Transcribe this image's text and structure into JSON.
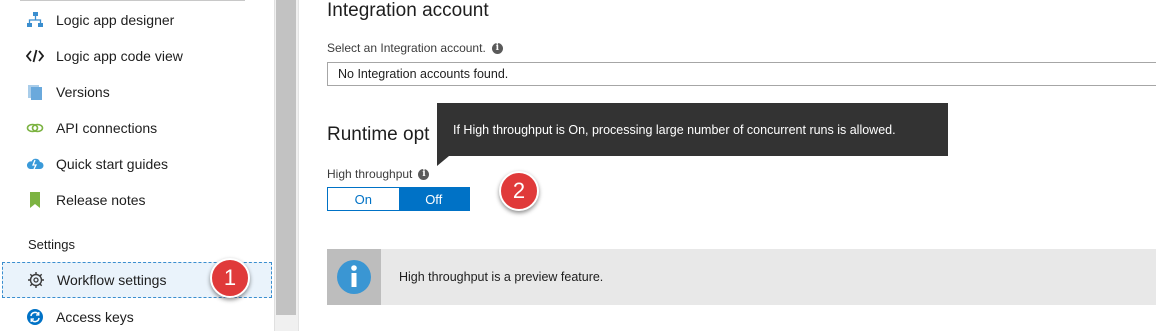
{
  "sidebar": {
    "items": [
      {
        "label": "Logic app designer",
        "icon": "designer-icon"
      },
      {
        "label": "Logic app code view",
        "icon": "code-icon"
      },
      {
        "label": "Versions",
        "icon": "versions-icon"
      },
      {
        "label": "API connections",
        "icon": "link-icon"
      },
      {
        "label": "Quick start guides",
        "icon": "cloud-icon"
      },
      {
        "label": "Release notes",
        "icon": "bookmark-icon"
      }
    ],
    "settings_heading": "Settings",
    "settings_items": [
      {
        "label": "Workflow settings",
        "icon": "gear-icon",
        "selected": true
      },
      {
        "label": "Access keys",
        "icon": "refresh-icon"
      }
    ]
  },
  "main": {
    "title": "Integration account",
    "select_label": "Select an Integration account.",
    "select_value": "No Integration accounts found.",
    "runtime_title": "Runtime opt",
    "throughput_label": "High throughput",
    "toggle": {
      "on_label": "On",
      "off_label": "Off",
      "selected": "Off"
    },
    "tooltip_text": "If High throughput is On, processing large number of concurrent runs is allowed.",
    "banner_text": "High throughput is a preview feature."
  },
  "annotations": {
    "badge1": "1",
    "badge2": "2"
  },
  "colors": {
    "accent": "#0072c6",
    "badge": "#e03a3a",
    "tooltip_bg": "#333333"
  }
}
